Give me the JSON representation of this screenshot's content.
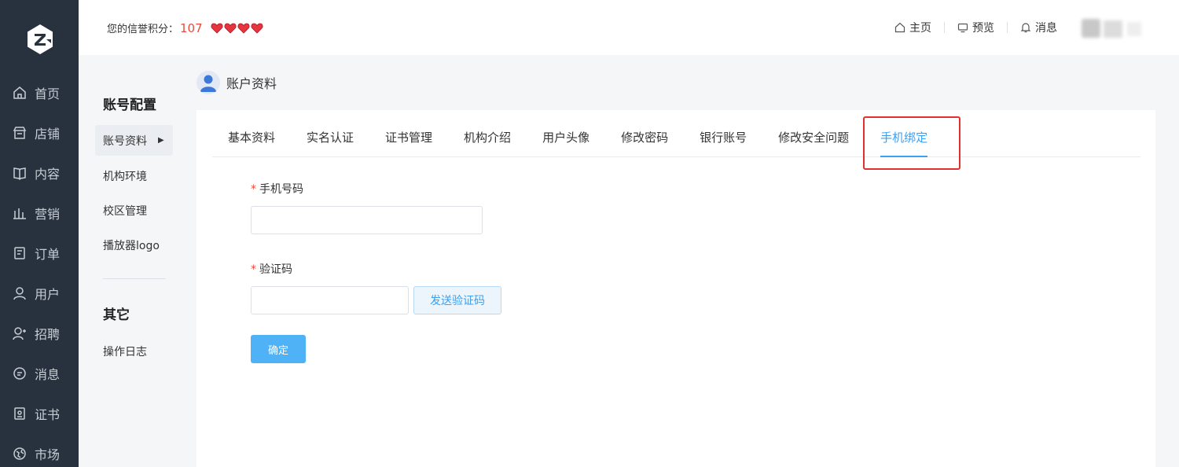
{
  "sidebar": {
    "items": [
      {
        "label": "首页",
        "icon": "home-icon"
      },
      {
        "label": "店铺",
        "icon": "store-icon"
      },
      {
        "label": "内容",
        "icon": "book-icon"
      },
      {
        "label": "营销",
        "icon": "bar-chart-icon"
      },
      {
        "label": "订单",
        "icon": "document-icon"
      },
      {
        "label": "用户",
        "icon": "user-icon"
      },
      {
        "label": "招聘",
        "icon": "user-add-icon"
      },
      {
        "label": "消息",
        "icon": "chat-icon"
      },
      {
        "label": "证书",
        "icon": "certificate-icon"
      },
      {
        "label": "市场",
        "icon": "globe-icon"
      }
    ]
  },
  "header": {
    "credit_label": "您的信誉积分：",
    "credit_score": "107",
    "heart_count": 4,
    "links": {
      "home": "主页",
      "preview": "预览",
      "messages": "消息"
    }
  },
  "submenu": {
    "section1_title": "账号配置",
    "active_item": "账号资料",
    "items": [
      "机构环境",
      "校区管理",
      "播放器logo"
    ],
    "section2_title": "其它",
    "section2_items": [
      "操作日志"
    ]
  },
  "page": {
    "title": "账户资料"
  },
  "tabs": [
    "基本资料",
    "实名认证",
    "证书管理",
    "机构介绍",
    "用户头像",
    "修改密码",
    "银行账号",
    "修改安全问题",
    "手机绑定"
  ],
  "active_tab_index": 8,
  "form": {
    "required_mark": "*",
    "phone_label": "手机号码",
    "phone_value": "",
    "code_label": "验证码",
    "code_value": "",
    "send_code_label": "发送验证码",
    "submit_label": "确定"
  },
  "colors": {
    "sidebar_bg": "#27323e",
    "accent": "#3ba0f2",
    "credit_red": "#e84c3d",
    "highlight_border": "#e0312e"
  }
}
